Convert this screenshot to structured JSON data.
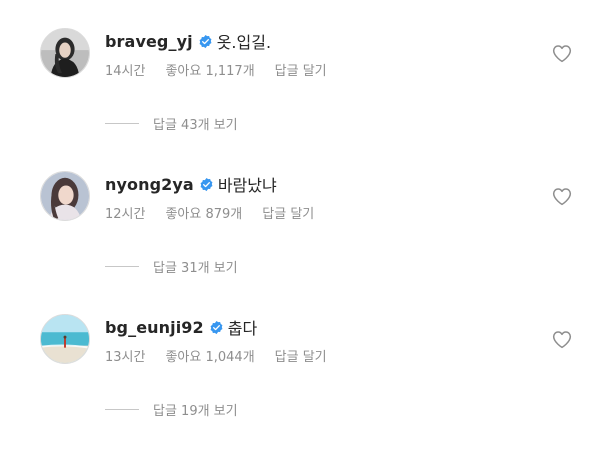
{
  "comments": [
    {
      "username": "braveg_yj",
      "text": "옷.입길.",
      "time": "14시간",
      "likes": "좋아요 1,117개",
      "reply_label": "답글 달기",
      "view_replies": "답글 43개 보기"
    },
    {
      "username": "nyong2ya",
      "text": "바람났냐",
      "time": "12시간",
      "likes": "좋아요 879개",
      "reply_label": "답글 달기",
      "view_replies": "답글 31개 보기"
    },
    {
      "username": "bg_eunji92",
      "text": "춥다",
      "time": "13시간",
      "likes": "좋아요 1,044개",
      "reply_label": "답글 달기",
      "view_replies": "답글 19개 보기"
    }
  ],
  "colors": {
    "verified": "#3897f0",
    "secondary_text": "#8e8e8e",
    "primary_text": "#262626"
  }
}
